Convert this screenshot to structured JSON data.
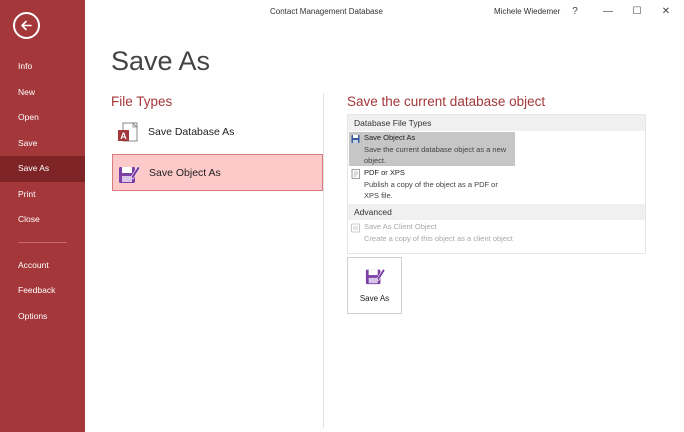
{
  "window": {
    "title": "Contact Management Database",
    "user": "Michele Wiedemer",
    "help": "?",
    "minimize": "—",
    "maximize": "☐",
    "close": "✕"
  },
  "sidebar": {
    "back_icon": "back-arrow-icon",
    "items_top": [
      {
        "label": "Info"
      },
      {
        "label": "New"
      },
      {
        "label": "Open"
      },
      {
        "label": "Save"
      },
      {
        "label": "Save As",
        "active": true
      },
      {
        "label": "Print"
      },
      {
        "label": "Close"
      }
    ],
    "items_bottom": [
      {
        "label": "Account"
      },
      {
        "label": "Feedback"
      },
      {
        "label": "Options"
      }
    ]
  },
  "main": {
    "title": "Save As",
    "file_types_title": "File Types",
    "file_types": [
      {
        "label": "Save Database As",
        "icon": "access-database-icon",
        "selected": false
      },
      {
        "label": "Save Object As",
        "icon": "save-object-icon",
        "selected": true
      }
    ]
  },
  "save_panel": {
    "title": "Save the current database object",
    "groups": [
      {
        "header": "Database File Types",
        "options": [
          {
            "title": "Save Object As",
            "desc": "Save the current database object as a new object.",
            "icon": "save-object-icon",
            "selected": true,
            "disabled": false
          },
          {
            "title": "PDF or XPS",
            "desc": "Publish a copy of the object as a PDF or XPS file.",
            "icon": "pdf-icon",
            "selected": false,
            "disabled": false
          }
        ]
      },
      {
        "header": "Advanced",
        "options": [
          {
            "title": "Save As Client Object",
            "desc": "Create a copy of this object as a client object",
            "icon": "client-object-icon",
            "selected": false,
            "disabled": true
          }
        ]
      }
    ],
    "button_label": "Save As"
  },
  "colors": {
    "accent": "#a4373a",
    "accent_dark": "#7e2427",
    "selected_fill": "#fdc9c9",
    "icon_purple": "#7b3fa5"
  }
}
